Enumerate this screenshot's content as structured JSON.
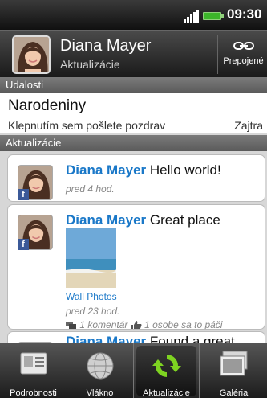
{
  "status": {
    "time": "09:30"
  },
  "profile": {
    "name": "Diana Mayer",
    "subtitle": "Aktualizácie",
    "link_label": "Prepojené"
  },
  "sections": {
    "events": "Udalosti",
    "updates": "Aktualizácie"
  },
  "event": {
    "title": "Narodeniny",
    "description": "Klepnutím sem pošlete pozdrav",
    "date": "Zajtra"
  },
  "feed": [
    {
      "author": "Diana Mayer",
      "text": "Hello world!",
      "time": "pred 4 hod."
    },
    {
      "author": "Diana Mayer",
      "text": "Great place",
      "photo_label": "Wall Photos",
      "time": "pred 23 hod.",
      "comments": "1 komentár",
      "likes": "1 osobe sa to páči"
    },
    {
      "author": "Diana Mayer",
      "text": "Found a great"
    }
  ],
  "tabs": [
    {
      "label": "Podrobnosti",
      "icon": "contact-card-icon"
    },
    {
      "label": "Vlákno",
      "icon": "globe-icon"
    },
    {
      "label": "Aktualizácie",
      "icon": "refresh-icon"
    },
    {
      "label": "Galéria",
      "icon": "gallery-icon"
    }
  ],
  "colors": {
    "link": "#1a78c8",
    "facebook": "#3b5998",
    "active_refresh": "#7ed321"
  }
}
